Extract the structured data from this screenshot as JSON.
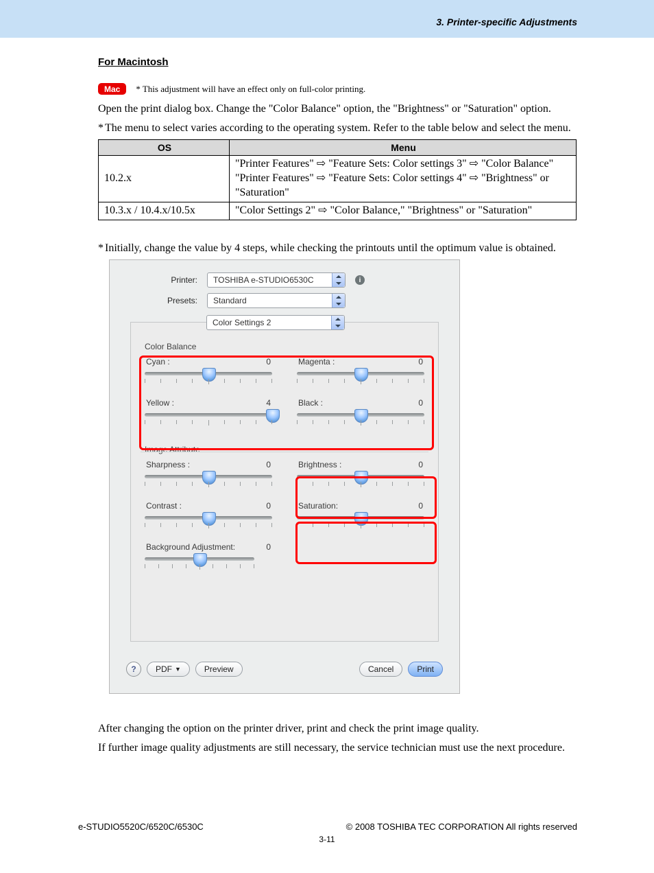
{
  "header": {
    "chapter": "3. Printer-specific Adjustments"
  },
  "section": {
    "title": "For Macintosh",
    "badge": "Mac",
    "badge_note": "* This adjustment will have an effect only on full-color printing.",
    "open_para": "Open the print dialog box.  Change the \"Color Balance\" option, the \"Brightness\" or \"Saturation\" option.",
    "star1": "The menu to select varies according to the operating system.  Refer to the table below and select the menu.",
    "star2": "Initially, change the value by 4 steps, while checking the printouts until the optimum value is obtained."
  },
  "table": {
    "h_os": "OS",
    "h_menu": "Menu",
    "rows": [
      {
        "os": "10.2.x",
        "menu_l1a": "\"Printer Features\" ",
        "menu_l1b": " \"Feature Sets: Color settings 3\" ",
        "menu_l1c": " \"Color Balance\"",
        "menu_l2a": "\"Printer Features\" ",
        "menu_l2b": " \"Feature Sets: Color settings 4\" ",
        "menu_l2c": " \"Brightness\" or \"Saturation\""
      },
      {
        "os": "10.3.x / 10.4.x/10.5x",
        "menu_a": "\"Color Settings 2\" ",
        "menu_b": " \"Color Balance,\" \"Brightness\" or \"Saturation\""
      }
    ]
  },
  "dialog": {
    "printer_label": "Printer:",
    "printer_value": "TOSHIBA e-STUDIO6530C",
    "presets_label": "Presets:",
    "presets_value": "Standard",
    "tab_value": "Color Settings 2",
    "group_cb": "Color Balance",
    "group_ia": "Image Attribute",
    "cyan": "Cyan :",
    "cyan_v": "0",
    "magenta": "Magenta :",
    "magenta_v": "0",
    "yellow": "Yellow :",
    "yellow_v": "4",
    "black": "Black :",
    "black_v": "0",
    "sharp": "Sharpness :",
    "sharp_v": "0",
    "bright": "Brightness :",
    "bright_v": "0",
    "contrast": "Contrast :",
    "contrast_v": "0",
    "sat": "Saturation:",
    "sat_v": "0",
    "bg": "Background Adjustment:",
    "bg_v": "0",
    "pdf": "PDF",
    "preview": "Preview",
    "cancel": "Cancel",
    "print": "Print",
    "help": "?",
    "info": "i"
  },
  "after": {
    "p1": "After changing the option on the printer driver, print and check the print image quality.",
    "p2": "If further image quality adjustments are still necessary, the service technician must use the next procedure."
  },
  "footer": {
    "model": "e-STUDIO5520C/6520C/6530C",
    "copy": "© 2008 TOSHIBA TEC CORPORATION All rights reserved",
    "page": "3-11"
  }
}
